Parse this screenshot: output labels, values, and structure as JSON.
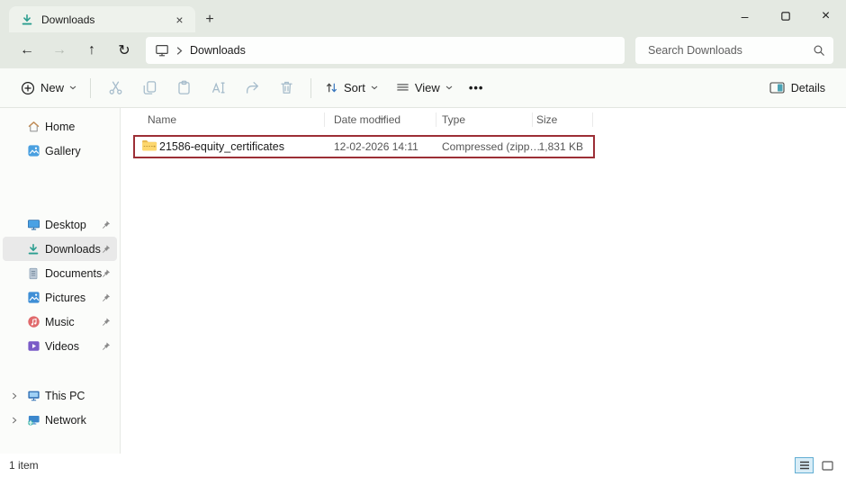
{
  "titlebar": {
    "tab_label": "Downloads"
  },
  "icons": {
    "tab_close": "×",
    "new_tab": "+",
    "minimize": "–",
    "close": "×",
    "back": "←",
    "forward": "→",
    "up": "↑",
    "refresh": "↻",
    "more": "•••"
  },
  "navbar": {
    "address_path": "Downloads",
    "search_placeholder": "Search Downloads"
  },
  "toolbar": {
    "new_label": "New",
    "sort_label": "Sort",
    "view_label": "View",
    "details_label": "Details"
  },
  "sidebar": {
    "items": [
      {
        "label": "Home",
        "pinned": false
      },
      {
        "label": "Gallery",
        "pinned": false
      },
      {
        "label": "Desktop",
        "pinned": true
      },
      {
        "label": "Downloads",
        "pinned": true,
        "selected": true
      },
      {
        "label": "Documents",
        "pinned": true
      },
      {
        "label": "Pictures",
        "pinned": true
      },
      {
        "label": "Music",
        "pinned": true
      },
      {
        "label": "Videos",
        "pinned": true
      },
      {
        "label": "This PC",
        "expandable": true
      },
      {
        "label": "Network",
        "expandable": true
      }
    ]
  },
  "file_list": {
    "columns": [
      "Name",
      "Date modified",
      "Type",
      "Size"
    ],
    "sorted_by": "Date modified",
    "rows": [
      {
        "name": "21586-equity_certificates",
        "date_modified": "12-02-2026 14:11",
        "type": "Compressed (zipp…",
        "size": "1,831 KB",
        "highlighted": true
      }
    ]
  },
  "statusbar": {
    "item_count": "1 item"
  },
  "colors": {
    "highlight_border": "#9c2f36",
    "tab_icon_teal": "#2a9d8f",
    "window_chrome": "#e4e9e2"
  }
}
